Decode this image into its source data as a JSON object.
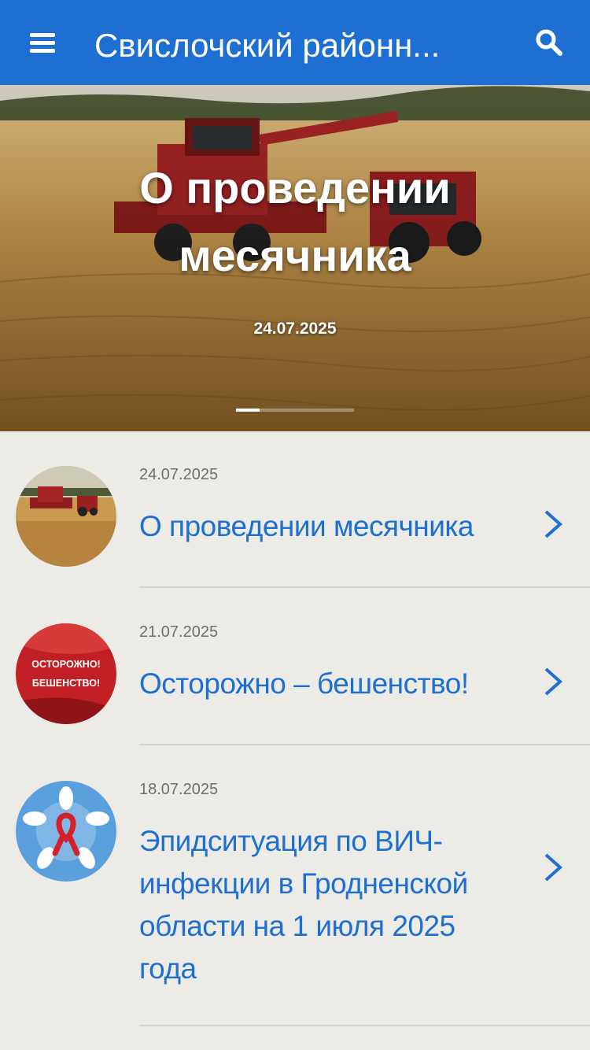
{
  "app": {
    "title": "Свислочский районн...",
    "accent_color": "#1e6fd2",
    "menu_icon": "hamburger-menu-icon",
    "search_icon": "search-icon"
  },
  "hero": {
    "title": "О проведении месячника",
    "date": "24.07.2025",
    "slide_count": 5,
    "active_slide": 1
  },
  "news": [
    {
      "date": "24.07.2025",
      "title": "О проведении месячника",
      "thumb": "harvester-field-thumbnail"
    },
    {
      "date": "21.07.2025",
      "title": "Осторожно – бешенство!",
      "thumb": "rabies-warning-thumbnail",
      "thumb_text": "ОСТОРОЖНО! БЕШЕНСТВО!"
    },
    {
      "date": "18.07.2025",
      "title": "Эпидситуация по ВИЧ-инфекции в Гродненской области на 1 июля 2025 года",
      "thumb": "red-ribbon-hands-thumbnail"
    }
  ]
}
